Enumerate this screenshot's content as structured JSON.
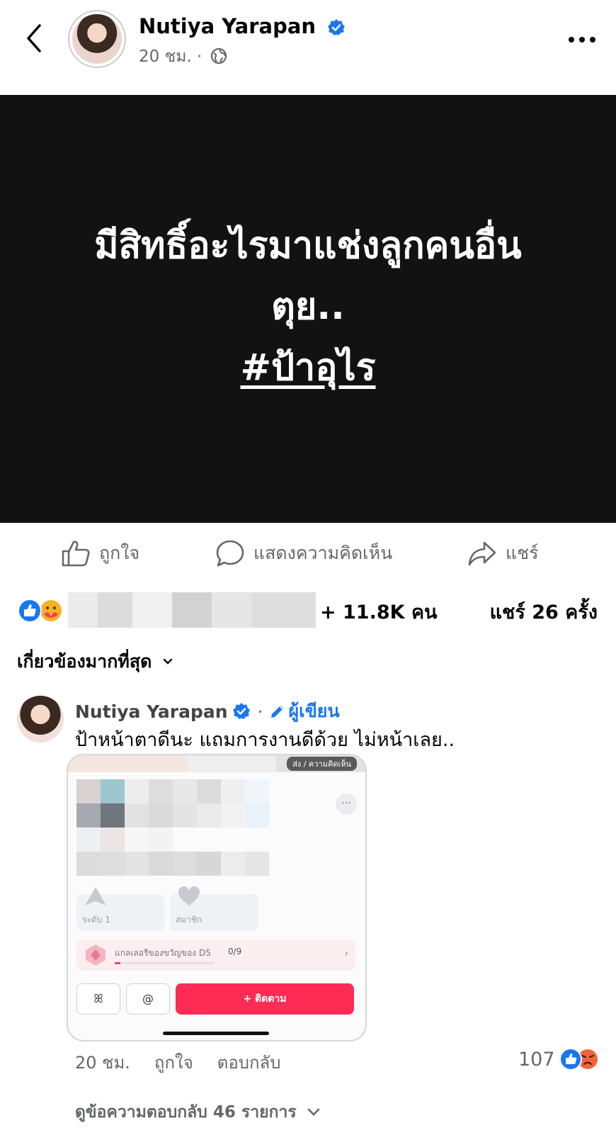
{
  "post": {
    "author": "Nutiya Yarapan",
    "time": "20 ชม.",
    "separator": "·",
    "image_lines": [
      "มีสิทธิ์อะไรมาแช่งลูกคนอื่น",
      "ตุย..",
      "#ป้าอุไร"
    ]
  },
  "actions": {
    "like": "ถูกใจ",
    "comment": "แสดงความคิดเห็น",
    "share": "แชร์"
  },
  "summary": {
    "reactions_count": "+ 11.8K คน",
    "shares": "แชร์ 26 ครั้ง"
  },
  "sort": {
    "label": "เกี่ยวข้องมากที่สุด"
  },
  "comment": {
    "author": "Nutiya Yarapan",
    "separator": "·",
    "author_badge": "ผู้เขียน",
    "text": "ป้าหน้าตาดีนะ แถมการงานดีด้วย ไม่หน้าเลย..",
    "time": "20 ชม.",
    "like": "ถูกใจ",
    "reply": "ตอบกลับ",
    "reaction_count": "107",
    "view_replies": "ดูข้อความตอบกลับ 46 รายการ",
    "screenshot": {
      "top_pill": "ส่ง / ความคิดเห็น",
      "more": "···",
      "card1": "ระดับ 1",
      "card2": "สมาชิก",
      "gallery_label": "แกลเลอรีของขวัญของ D5",
      "gallery_progress_text": "0/9",
      "gallery_progress": 0.06,
      "btn_friends": "ꕤ",
      "btn_mention": "@",
      "follow": "+ ติดตาม"
    }
  },
  "colors": {
    "brand_blue": "#1877f2",
    "image_bg": "#121212",
    "follow_red": "#fe2c55",
    "secondary_text": "#65676b"
  },
  "icons": [
    "back-arrow-icon",
    "verified-badge-icon",
    "globe-icon",
    "more-dots-icon",
    "like-thumb-icon",
    "comment-bubble-icon",
    "share-arrow-icon",
    "like-reaction-icon",
    "care-reaction-icon",
    "angry-reaction-icon",
    "pencil-icon",
    "chevron-down-icon"
  ]
}
